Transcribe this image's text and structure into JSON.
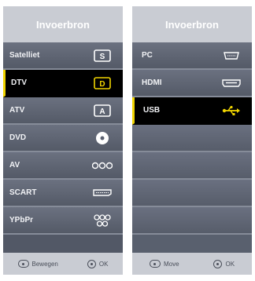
{
  "accent_color": "#f0d400",
  "left_panel": {
    "title": "Invoerbron",
    "items": [
      {
        "label": "Satelliet",
        "icon": "satellite-icon"
      },
      {
        "label": "DTV",
        "icon": "dtv-icon",
        "selected": true
      },
      {
        "label": "ATV",
        "icon": "atv-icon"
      },
      {
        "label": "DVD",
        "icon": "disc-icon"
      },
      {
        "label": "AV",
        "icon": "av-jacks-icon"
      },
      {
        "label": "SCART",
        "icon": "scart-icon"
      },
      {
        "label": "YPbPr",
        "icon": "ypbpr-jacks-icon"
      }
    ],
    "footer": {
      "move_label": "Bewegen",
      "ok_label": "OK"
    }
  },
  "right_panel": {
    "title": "Invoerbron",
    "items": [
      {
        "label": "PC",
        "icon": "vga-icon"
      },
      {
        "label": "HDMI",
        "icon": "hdmi-icon"
      },
      {
        "label": "USB",
        "icon": "usb-icon",
        "selected": true
      }
    ],
    "footer": {
      "move_label": "Move",
      "ok_label": "OK"
    }
  }
}
